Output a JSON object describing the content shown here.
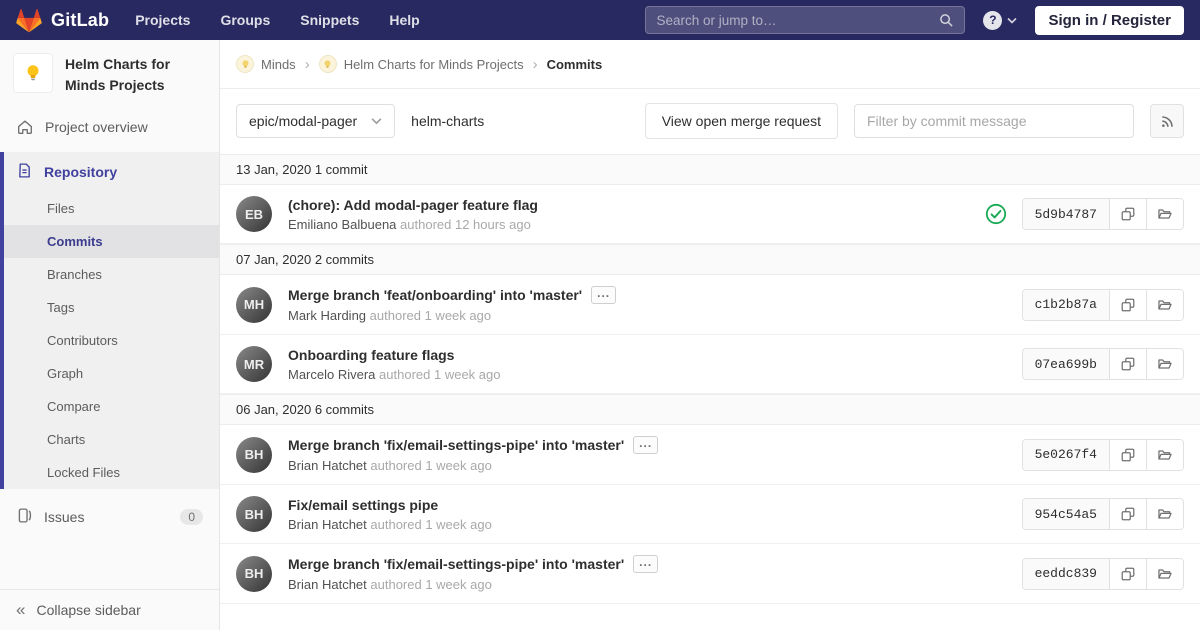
{
  "colors": {
    "navbar_bg": "#292961",
    "accent": "#41419f",
    "success": "#1aaa55",
    "brand_orange": "#fc6d26"
  },
  "navbar": {
    "brand": "GitLab",
    "links": [
      {
        "label": "Projects"
      },
      {
        "label": "Groups"
      },
      {
        "label": "Snippets"
      },
      {
        "label": "Help"
      }
    ],
    "search_placeholder": "Search or jump to…",
    "help_glyph": "?",
    "sign_in_label": "Sign in / Register"
  },
  "breadcrumb": {
    "separator": "›",
    "items": [
      {
        "label": "Minds"
      },
      {
        "label": "Helm Charts for Minds Projects"
      }
    ],
    "current": "Commits"
  },
  "sidebar": {
    "project_title": "Helm Charts for Minds Projects",
    "overview_label": "Project overview",
    "repository_label": "Repository",
    "repo_items": [
      {
        "label": "Files"
      },
      {
        "label": "Commits"
      },
      {
        "label": "Branches"
      },
      {
        "label": "Tags"
      },
      {
        "label": "Contributors"
      },
      {
        "label": "Graph"
      },
      {
        "label": "Compare"
      },
      {
        "label": "Charts"
      },
      {
        "label": "Locked Files"
      }
    ],
    "issues_label": "Issues",
    "issues_count": "0",
    "collapse_glyph": "«",
    "collapse_label": "Collapse sidebar"
  },
  "controls": {
    "branch": "epic/modal-pager",
    "ref_name": "helm-charts",
    "merge_request_button": "View open merge request",
    "filter_placeholder": "Filter by commit message"
  },
  "commits": {
    "expand_glyph": "...",
    "groups": [
      {
        "date": "13 Jan, 2020",
        "count_label": "1 commit",
        "commits": [
          {
            "title": "(chore): Add modal-pager feature flag",
            "author": "Emiliano Balbuena",
            "authored": "authored 12 hours ago",
            "sha": "5d9b4787",
            "avatar_initials": "EB",
            "pipeline_status": "passed"
          }
        ]
      },
      {
        "date": "07 Jan, 2020",
        "count_label": "2 commits",
        "commits": [
          {
            "title": "Merge branch 'feat/onboarding' into 'master'",
            "author": "Mark Harding",
            "authored": "authored 1 week ago",
            "sha": "c1b2b87a",
            "avatar_initials": "MH"
          },
          {
            "title": "Onboarding feature flags",
            "author": "Marcelo Rivera",
            "authored": "authored 1 week ago",
            "sha": "07ea699b",
            "avatar_initials": "MR"
          }
        ]
      },
      {
        "date": "06 Jan, 2020",
        "count_label": "6 commits",
        "commits": [
          {
            "title": "Merge branch 'fix/email-settings-pipe' into 'master'",
            "author": "Brian Hatchet",
            "authored": "authored 1 week ago",
            "sha": "5e0267f4",
            "avatar_initials": "BH"
          },
          {
            "title": "Fix/email settings pipe",
            "author": "Brian Hatchet",
            "authored": "authored 1 week ago",
            "sha": "954c54a5",
            "avatar_initials": "BH"
          },
          {
            "title": "Merge branch 'fix/email-settings-pipe' into 'master'",
            "author": "Brian Hatchet",
            "authored": "authored 1 week ago",
            "sha": "eeddc839",
            "avatar_initials": "BH"
          }
        ]
      }
    ]
  }
}
